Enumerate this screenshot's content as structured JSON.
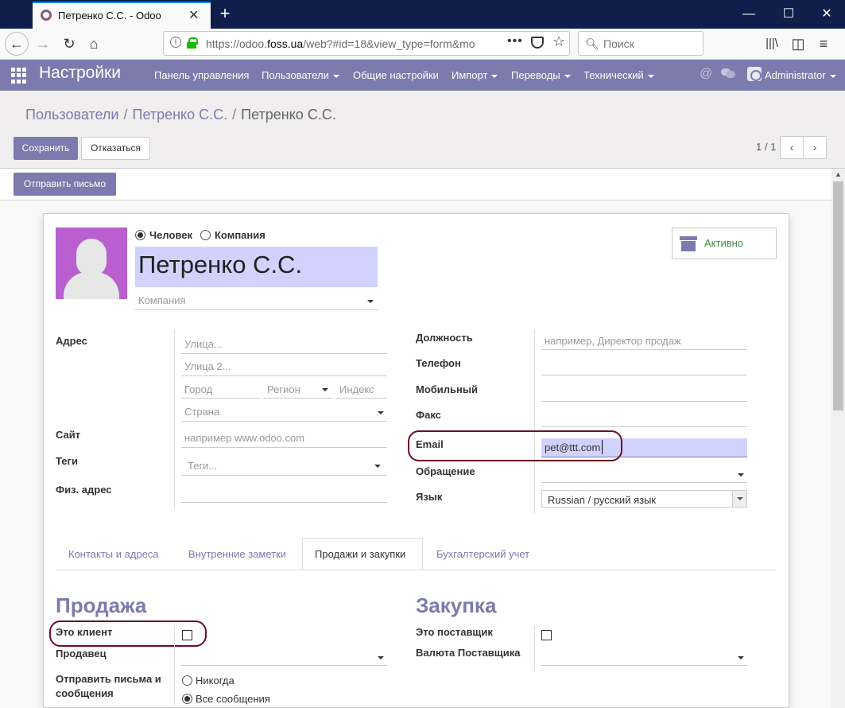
{
  "browser": {
    "tab_title": "Петренко С.С. - Odoo",
    "url_prefix": "https://odoo.",
    "url_domain": "foss.ua",
    "url_rest": "/web?#id=18&view_type=form&mo",
    "search_placeholder": "Поиск"
  },
  "topmenu": {
    "app_title": "Настройки",
    "items": [
      "Панель управления",
      "Пользователи",
      "Общие настройки",
      "Импорт",
      "Переводы",
      "Технический"
    ],
    "user": "Administrator"
  },
  "control_panel": {
    "breadcrumb": [
      "Пользователи",
      "Петренко С.С.",
      "Петренко С.С."
    ],
    "save_label": "Сохранить",
    "discard_label": "Отказаться",
    "pager": "1 / 1"
  },
  "statusbar": {
    "send_mail_label": "Отправить письмо"
  },
  "form": {
    "type_person": "Человек",
    "type_company": "Компания",
    "name": "Петренко С.С.",
    "company_placeholder": "Компания",
    "active_label": "Активно",
    "address_label": "Адрес",
    "street_ph": "Улица...",
    "street2_ph": "Улица 2...",
    "city_ph": "Город",
    "state_ph": "Регион",
    "zip_ph": "Индекс",
    "country_ph": "Страна",
    "website_label": "Сайт",
    "website_ph": "например www.odoo.com",
    "tags_label": "Теги",
    "tags_ph": "Теги...",
    "phys_address_label": "Физ. адрес",
    "job_label": "Должность",
    "job_ph": "например, Директор продаж",
    "phone_label": "Телефон",
    "mobile_label": "Мобильный",
    "fax_label": "Факс",
    "email_label": "Email",
    "email_value": "pet@ttt.com",
    "title_label": "Обращение",
    "lang_label": "Язык",
    "lang_value": "Russian / русский язык"
  },
  "tabs": [
    "Контакты и адреса",
    "Внутренние заметки",
    "Продажи и закупки",
    "Бухгалтерский учет"
  ],
  "sales": {
    "title": "Продажа",
    "customer_label": "Это клиент",
    "salesperson_label": "Продавец",
    "send_label_1": "Отправить письма и",
    "send_label_2": "сообщения",
    "opt_never": "Никогда",
    "opt_all": "Все сообщения"
  },
  "purchase": {
    "title": "Закупка",
    "supplier_label": "Это поставщик",
    "currency_label": "Валюта Поставщика"
  },
  "colors": {
    "brand": "#7c7bad",
    "highlight": "#d2d2ff",
    "annotation": "#6b1022"
  }
}
